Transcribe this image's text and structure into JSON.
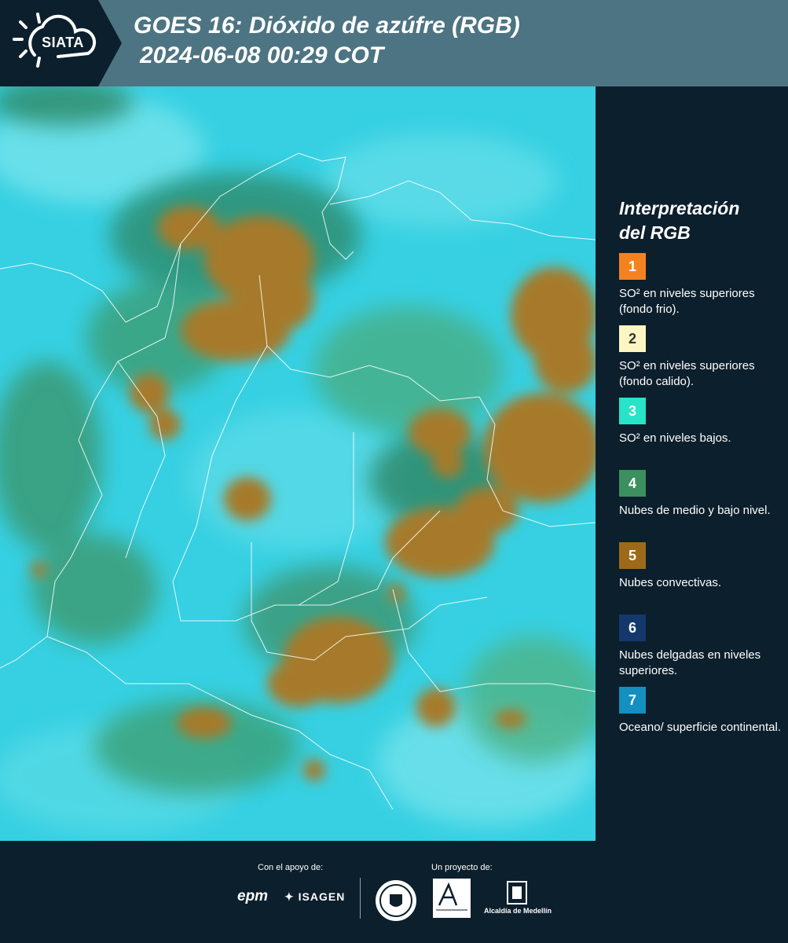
{
  "header": {
    "logo_text": "SIATA",
    "title_line1": "GOES 16: Dióxido de azúfre (RGB)",
    "title_line2": "2024-06-08 00:29 COT"
  },
  "legend": {
    "title_line1": "Interpretación",
    "title_line2": "del RGB",
    "items": [
      {
        "number": "1",
        "color": "#f58220",
        "text": "SO² en niveles superiores (fondo frio)."
      },
      {
        "number": "2",
        "color": "#fdf6c2",
        "text": "SO² en niveles superiores (fondo calido)."
      },
      {
        "number": "3",
        "color": "#27e3c8",
        "text": "SO² en niveles bajos."
      },
      {
        "number": "4",
        "color": "#3c8f5e",
        "text": "Nubes de medio y bajo nivel."
      },
      {
        "number": "5",
        "color": "#9c6a18",
        "text": "Nubes convectivas."
      },
      {
        "number": "6",
        "color": "#15386c",
        "text": "Nubes delgadas en niveles superiores."
      },
      {
        "number": "7",
        "color": "#138fc0",
        "text": "Oceano/ superficie continental."
      }
    ]
  },
  "footer": {
    "support_label": "Con el apoyo de:",
    "project_label": "Un proyecto de:",
    "sponsor_1": "epm",
    "sponsor_2": "ISAGEN",
    "partner_3": "Alcaldía de Medellín"
  }
}
